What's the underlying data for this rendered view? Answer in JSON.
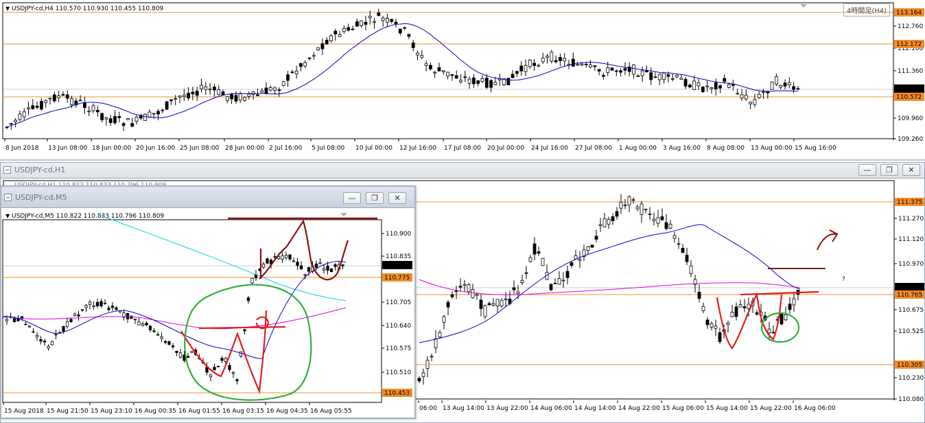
{
  "colors": {
    "orange": "#f28c28",
    "ma_blue": "#0000c8",
    "ma_magenta": "#e000e0",
    "ma_cyan": "#00d4e6",
    "draw_red": "#e21c1c",
    "draw_darkred": "#8b1010",
    "draw_green": "#2fae3b",
    "bid": "#9a9a9a"
  },
  "h4": {
    "header": "USDJPY-cd,H4  110.570 110.930 110.455 110.809",
    "timeframe_label": "4時間足(H4)",
    "price_labels": [
      "112.760",
      "112.160",
      "111.360",
      "109.960",
      "109.260"
    ],
    "badges": [
      "113.164",
      "112.172",
      "110.809",
      "110.572"
    ],
    "time_labels": [
      "8 Jun 2018",
      "13 Jun 08:00",
      "18 Jun 00:00",
      "20 Jun 16:00",
      "25 Jun 08:00",
      "28 Jun 00:00",
      "2 Jul 16:00",
      "5 Jul 08:00",
      "10 Jul 00:00",
      "12 Jul 16:00",
      "17 Jul 08:00",
      "20 Jul 00:00",
      "24 Jul 16:00",
      "27 Jul 08:00",
      "1 Aug 00:00",
      "3 Aug 16:00",
      "8 Aug 08:00",
      "13 Aug 00:00",
      "15 Aug 16:00"
    ]
  },
  "h1": {
    "title": "USDJPY-cd,H1",
    "header": "USDJPY-cd,H1  110.822 110.833 110.796 110.809",
    "price_labels": [
      "111.270",
      "111.120",
      "110.970",
      "110.675",
      "110.525",
      "110.230",
      "110.080"
    ],
    "badges": [
      "111.375",
      "110.809",
      "110.765",
      "110.305"
    ],
    "time_labels": [
      "06:00",
      "13 Aug 14:00",
      "13 Aug 22:00",
      "14 Aug 06:00",
      "14 Aug 14:00",
      "14 Aug 22:00",
      "15 Aug 06:00",
      "15 Aug 14:00",
      "15 Aug 22:00",
      "16 Aug 06:00"
    ],
    "question_mark": "?"
  },
  "m5": {
    "title": "USDJPY-cd,M5",
    "header": "USDJPY-cd,M5  110.822 110.833 110.796 110.809",
    "price_labels": [
      "110.900",
      "110.835",
      "110.705",
      "110.640",
      "110.575",
      "110.510"
    ],
    "badges": [
      "110.809",
      "110.775",
      "110.453"
    ],
    "time_labels": [
      "15 Aug 2018",
      "15 Aug 21:50",
      "15 Aug 23:10",
      "16 Aug 00:35",
      "16 Aug 01:55",
      "16 Aug 03:15",
      "16 Aug 04:35",
      "16 Aug 05:55"
    ]
  },
  "window_buttons": {
    "minimize": "—",
    "restore": "❐",
    "close": "✕"
  }
}
